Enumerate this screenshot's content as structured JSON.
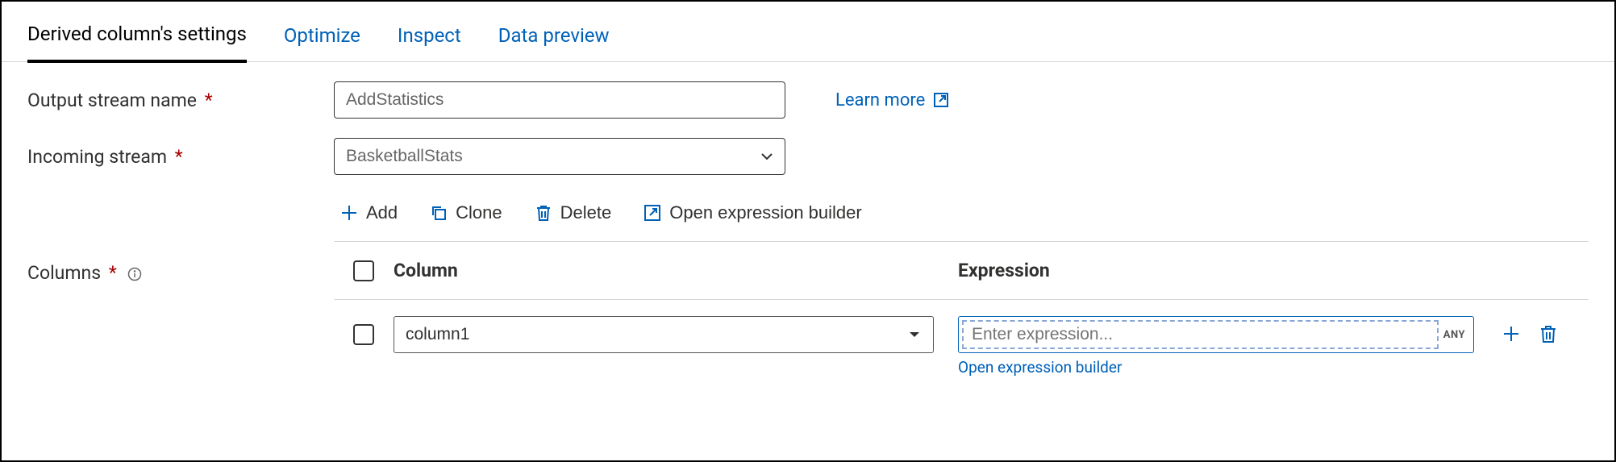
{
  "tabs": {
    "settings": "Derived column's settings",
    "optimize": "Optimize",
    "inspect": "Inspect",
    "preview": "Data preview"
  },
  "labels": {
    "output_stream_name": "Output stream name",
    "incoming_stream": "Incoming stream",
    "columns": "Columns",
    "required_marker": "*"
  },
  "values": {
    "output_stream_name": "AddStatistics",
    "incoming_stream": "BasketballStats"
  },
  "learn_more": "Learn more",
  "toolbar": {
    "add": "Add",
    "clone": "Clone",
    "delete": "Delete",
    "open_builder": "Open expression builder"
  },
  "table": {
    "header_column": "Column",
    "header_expression": "Expression",
    "rows": [
      {
        "column_name": "column1",
        "expression_value": "",
        "expression_placeholder": "Enter expression...",
        "expression_type_badge": "ANY",
        "open_builder_link": "Open expression builder"
      }
    ]
  },
  "colors": {
    "accent": "#0061b8",
    "required": "#a80000"
  }
}
